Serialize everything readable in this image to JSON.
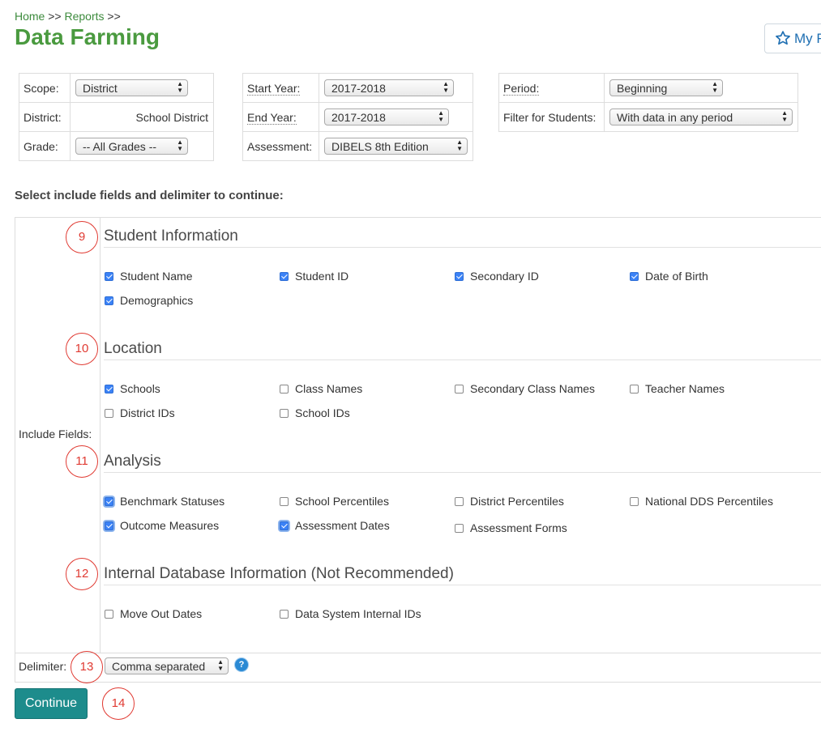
{
  "breadcrumb": {
    "home": "Home",
    "sep1": " >> ",
    "reports": "Reports",
    "sep2": " >>"
  },
  "page_title": "Data Farming",
  "my_button_label": "My F",
  "filters": {
    "scope_label": "Scope:",
    "scope_value": "District",
    "district_label": "District:",
    "district_value": "School District",
    "grade_label": "Grade:",
    "grade_value": "-- All Grades --",
    "start_year_label": "Start Year:",
    "start_year_value": "2017-2018",
    "end_year_label": "End Year:",
    "end_year_value": "2017-2018",
    "assessment_label": "Assessment:",
    "assessment_value": "DIBELS 8th Edition",
    "period_label": "Period:",
    "period_value": "Beginning",
    "filter_students_label": "Filter for Students:",
    "filter_students_value": "With data in any period"
  },
  "instruction": "Select include fields and delimiter to continue:",
  "include_fields_label": "Include Fields:",
  "sections": {
    "student": {
      "number": "9",
      "title": "Student Information",
      "items": [
        {
          "label": "Student Name",
          "checked": true
        },
        {
          "label": "Student ID",
          "checked": true
        },
        {
          "label": "Secondary ID",
          "checked": true
        },
        {
          "label": "Date of Birth",
          "checked": true
        },
        {
          "label": "Demographics",
          "checked": true
        }
      ]
    },
    "location": {
      "number": "10",
      "title": "Location",
      "items": [
        {
          "label": "Schools",
          "checked": true
        },
        {
          "label": "Class Names",
          "checked": false
        },
        {
          "label": "Secondary Class Names",
          "checked": false
        },
        {
          "label": "Teacher Names",
          "checked": false
        },
        {
          "label": "District IDs",
          "checked": false
        },
        {
          "label": "School IDs",
          "checked": false
        }
      ]
    },
    "analysis": {
      "number": "11",
      "title": "Analysis",
      "items": [
        {
          "label": "Benchmark Statuses",
          "checked": true
        },
        {
          "label": "School Percentiles",
          "checked": false
        },
        {
          "label": "District Percentiles",
          "checked": false
        },
        {
          "label": "National DDS Percentiles",
          "checked": false
        },
        {
          "label": "Outcome Measures",
          "checked": true
        },
        {
          "label": "Assessment Dates",
          "checked": true
        },
        {
          "label": "Assessment Forms",
          "checked": false
        }
      ]
    },
    "internal": {
      "number": "12",
      "title": "Internal Database Information (Not Recommended)",
      "items": [
        {
          "label": "Move Out Dates",
          "checked": false
        },
        {
          "label": "Data System Internal IDs",
          "checked": false
        }
      ]
    }
  },
  "delimiter": {
    "label": "Delimiter:",
    "number": "13",
    "value": "Comma separated",
    "help": "?"
  },
  "continue": {
    "label": "Continue",
    "number": "14"
  }
}
